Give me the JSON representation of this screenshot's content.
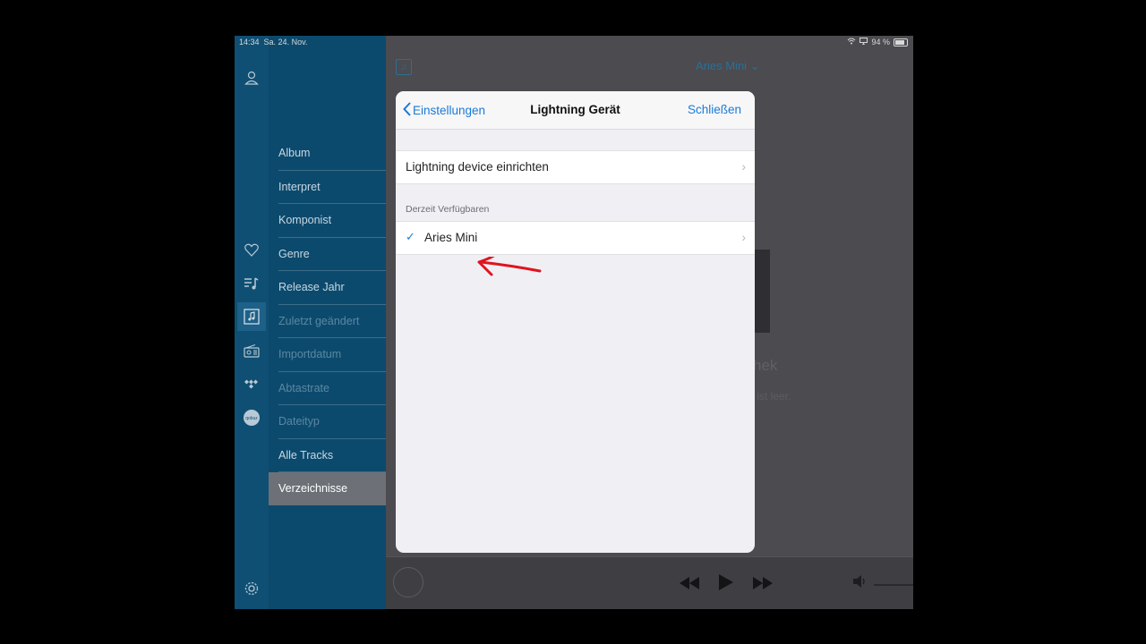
{
  "status_bar": {
    "time": "14:34",
    "date": "Sa. 24. Nov.",
    "battery": "94 %"
  },
  "icon_bar": {
    "icons": [
      "person-icon",
      "heart-icon",
      "playlist-icon",
      "library-icon",
      "radio-icon",
      "tidal-icon",
      "qobuz-icon",
      "gear-icon"
    ],
    "qobuz_text": "qobuz"
  },
  "sidebar": {
    "items": [
      {
        "label": "Album",
        "state": "normal"
      },
      {
        "label": "Interpret",
        "state": "normal"
      },
      {
        "label": "Komponist",
        "state": "normal"
      },
      {
        "label": "Genre",
        "state": "normal"
      },
      {
        "label": "Release Jahr",
        "state": "normal"
      },
      {
        "label": "Zuletzt geändert",
        "state": "dim"
      },
      {
        "label": "Importdatum",
        "state": "dim"
      },
      {
        "label": "Abtastrate",
        "state": "dim"
      },
      {
        "label": "Dateityp",
        "state": "dim"
      },
      {
        "label": "Alle Tracks",
        "state": "normal"
      },
      {
        "label": "Verzeichnisse",
        "state": "selected"
      }
    ]
  },
  "main": {
    "device_title": "Aries Mini",
    "bg_text_1": "hek",
    "bg_text_2": "k ist leer."
  },
  "modal": {
    "back_label": "Einstellungen",
    "title": "Lightning Gerät",
    "close_label": "Schließen",
    "setup_row": "Lightning device einrichten",
    "section_header": "Derzeit Verfügbaren",
    "device_row": "Aries Mini"
  },
  "colors": {
    "accent": "#1b7ad6",
    "annotation": "#e0141e",
    "sidebar_bg": "#0c4a6d"
  }
}
